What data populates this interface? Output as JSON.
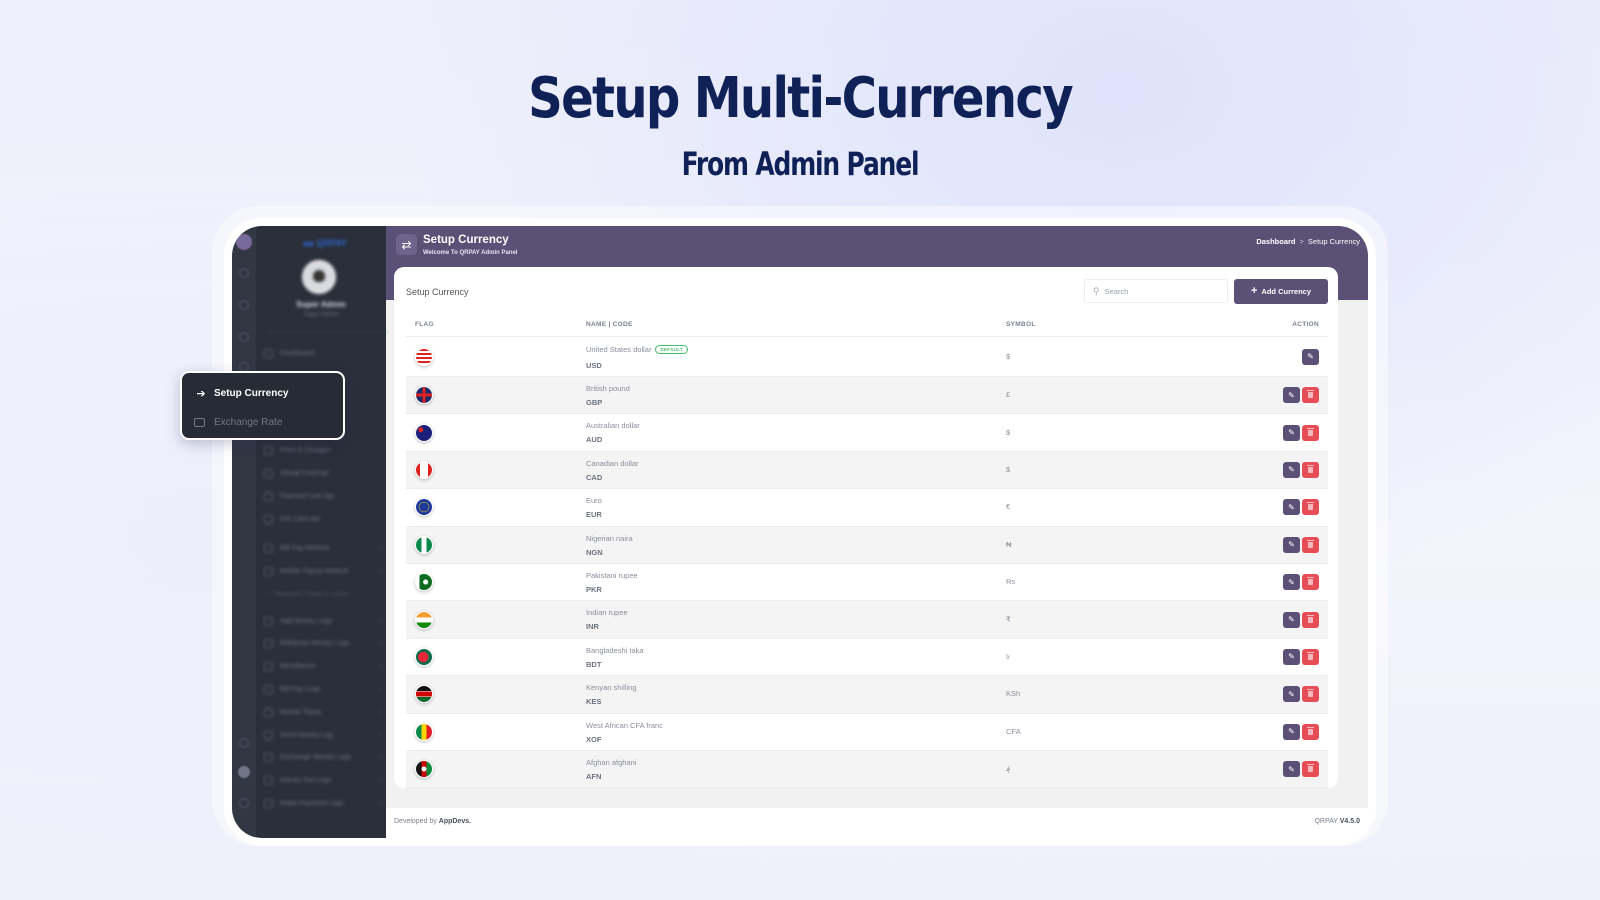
{
  "hero": {
    "title": "Setup Multi-Currency",
    "subtitle": "From Admin Panel"
  },
  "sidebar": {
    "brand": "QRPAY",
    "user_name": "Super Admin",
    "user_role": "Super Admin",
    "items_top": [
      {
        "label": "Dashboard",
        "icon": "link-icon"
      }
    ],
    "items_mid": [
      {
        "label": "Fees & Charges",
        "icon": "download-icon",
        "chevron": false
      },
      {
        "label": "Virtual Card Api",
        "icon": "card-icon",
        "chevron": false
      },
      {
        "label": "Payment Link Api",
        "icon": "code-icon",
        "chevron": false
      },
      {
        "label": "Gift Card Api",
        "icon": "gift-icon",
        "chevron": false
      },
      {
        "label": "Bill Pay Method",
        "icon": "bag-icon",
        "chevron": true
      },
      {
        "label": "Mobile TopUp Method",
        "icon": "phone-icon",
        "chevron": true
      }
    ],
    "section_label": "— TRANSACTIONS & LOGS",
    "items_logs": [
      {
        "label": "Add Money Logs",
        "icon": "calculator-icon"
      },
      {
        "label": "Withdraw Money Logs",
        "icon": "withdraw-icon"
      },
      {
        "label": "Remittance",
        "icon": "calculator-icon"
      },
      {
        "label": "Bill Pay Logs",
        "icon": "bag-icon"
      },
      {
        "label": "Mobile Topup",
        "icon": "phone-icon"
      },
      {
        "label": "Send Money Log",
        "icon": "send-icon"
      },
      {
        "label": "Exchange Money Logs",
        "icon": "send-icon"
      },
      {
        "label": "Money Out Logs",
        "icon": "minus-circle-icon"
      },
      {
        "label": "Make Payment Logs",
        "icon": "minus-circle-icon"
      }
    ]
  },
  "popover": {
    "active_label": "Setup Currency",
    "other_label": "Exchange Rate"
  },
  "header": {
    "title": "Setup Currency",
    "subtitle": "Welcome To QRPAY Admin Panel",
    "breadcrumb": {
      "home": "Dashboard",
      "separator": ">",
      "current": "Setup Currency"
    }
  },
  "card": {
    "title": "Setup Currency",
    "search_placeholder": "Search",
    "add_button": "Add Currency"
  },
  "table": {
    "columns": [
      "FLAG",
      "NAME | CODE",
      "SYMBOL",
      "ACTION"
    ],
    "default_badge": "DEFAULT",
    "rows": [
      {
        "name": "United States dollar",
        "code": "USD",
        "symbol": "$",
        "flag": "us",
        "default": true,
        "deletable": false
      },
      {
        "name": "British pound",
        "code": "GBP",
        "symbol": "£",
        "flag": "gb",
        "default": false,
        "deletable": true
      },
      {
        "name": "Australian dollar",
        "code": "AUD",
        "symbol": "$",
        "flag": "au",
        "default": false,
        "deletable": true
      },
      {
        "name": "Canadian dollar",
        "code": "CAD",
        "symbol": "$",
        "flag": "ca",
        "default": false,
        "deletable": true
      },
      {
        "name": "Euro",
        "code": "EUR",
        "symbol": "€",
        "flag": "eu",
        "default": false,
        "deletable": true
      },
      {
        "name": "Nigerian naira",
        "code": "NGN",
        "symbol": "₦",
        "flag": "ng",
        "default": false,
        "deletable": true
      },
      {
        "name": "Pakistani rupee",
        "code": "PKR",
        "symbol": "Rs",
        "flag": "pk",
        "default": false,
        "deletable": true
      },
      {
        "name": "Indian rupee",
        "code": "INR",
        "symbol": "₹",
        "flag": "in",
        "default": false,
        "deletable": true
      },
      {
        "name": "Bangladeshi taka",
        "code": "BDT",
        "symbol": "৳",
        "flag": "bd",
        "default": false,
        "deletable": true
      },
      {
        "name": "Kenyan shilling",
        "code": "KES",
        "symbol": "KSh",
        "flag": "ke",
        "default": false,
        "deletable": true
      },
      {
        "name": "West African CFA franc",
        "code": "XOF",
        "symbol": "CFA",
        "flag": "sn",
        "default": false,
        "deletable": true
      },
      {
        "name": "Afghan afghani",
        "code": "AFN",
        "symbol": "؋",
        "flag": "af",
        "default": false,
        "deletable": true
      }
    ]
  },
  "footer": {
    "developed_prefix": "Developed by",
    "developer": "AppDevs.",
    "product": "QRPAY",
    "version": "V4.5.0"
  },
  "colors": {
    "primary": "#5b5076",
    "danger": "#e64d57",
    "sidebar_bg": "#2a2f3a",
    "hero_text": "#0f2156",
    "badge": "#3fbf6a"
  }
}
